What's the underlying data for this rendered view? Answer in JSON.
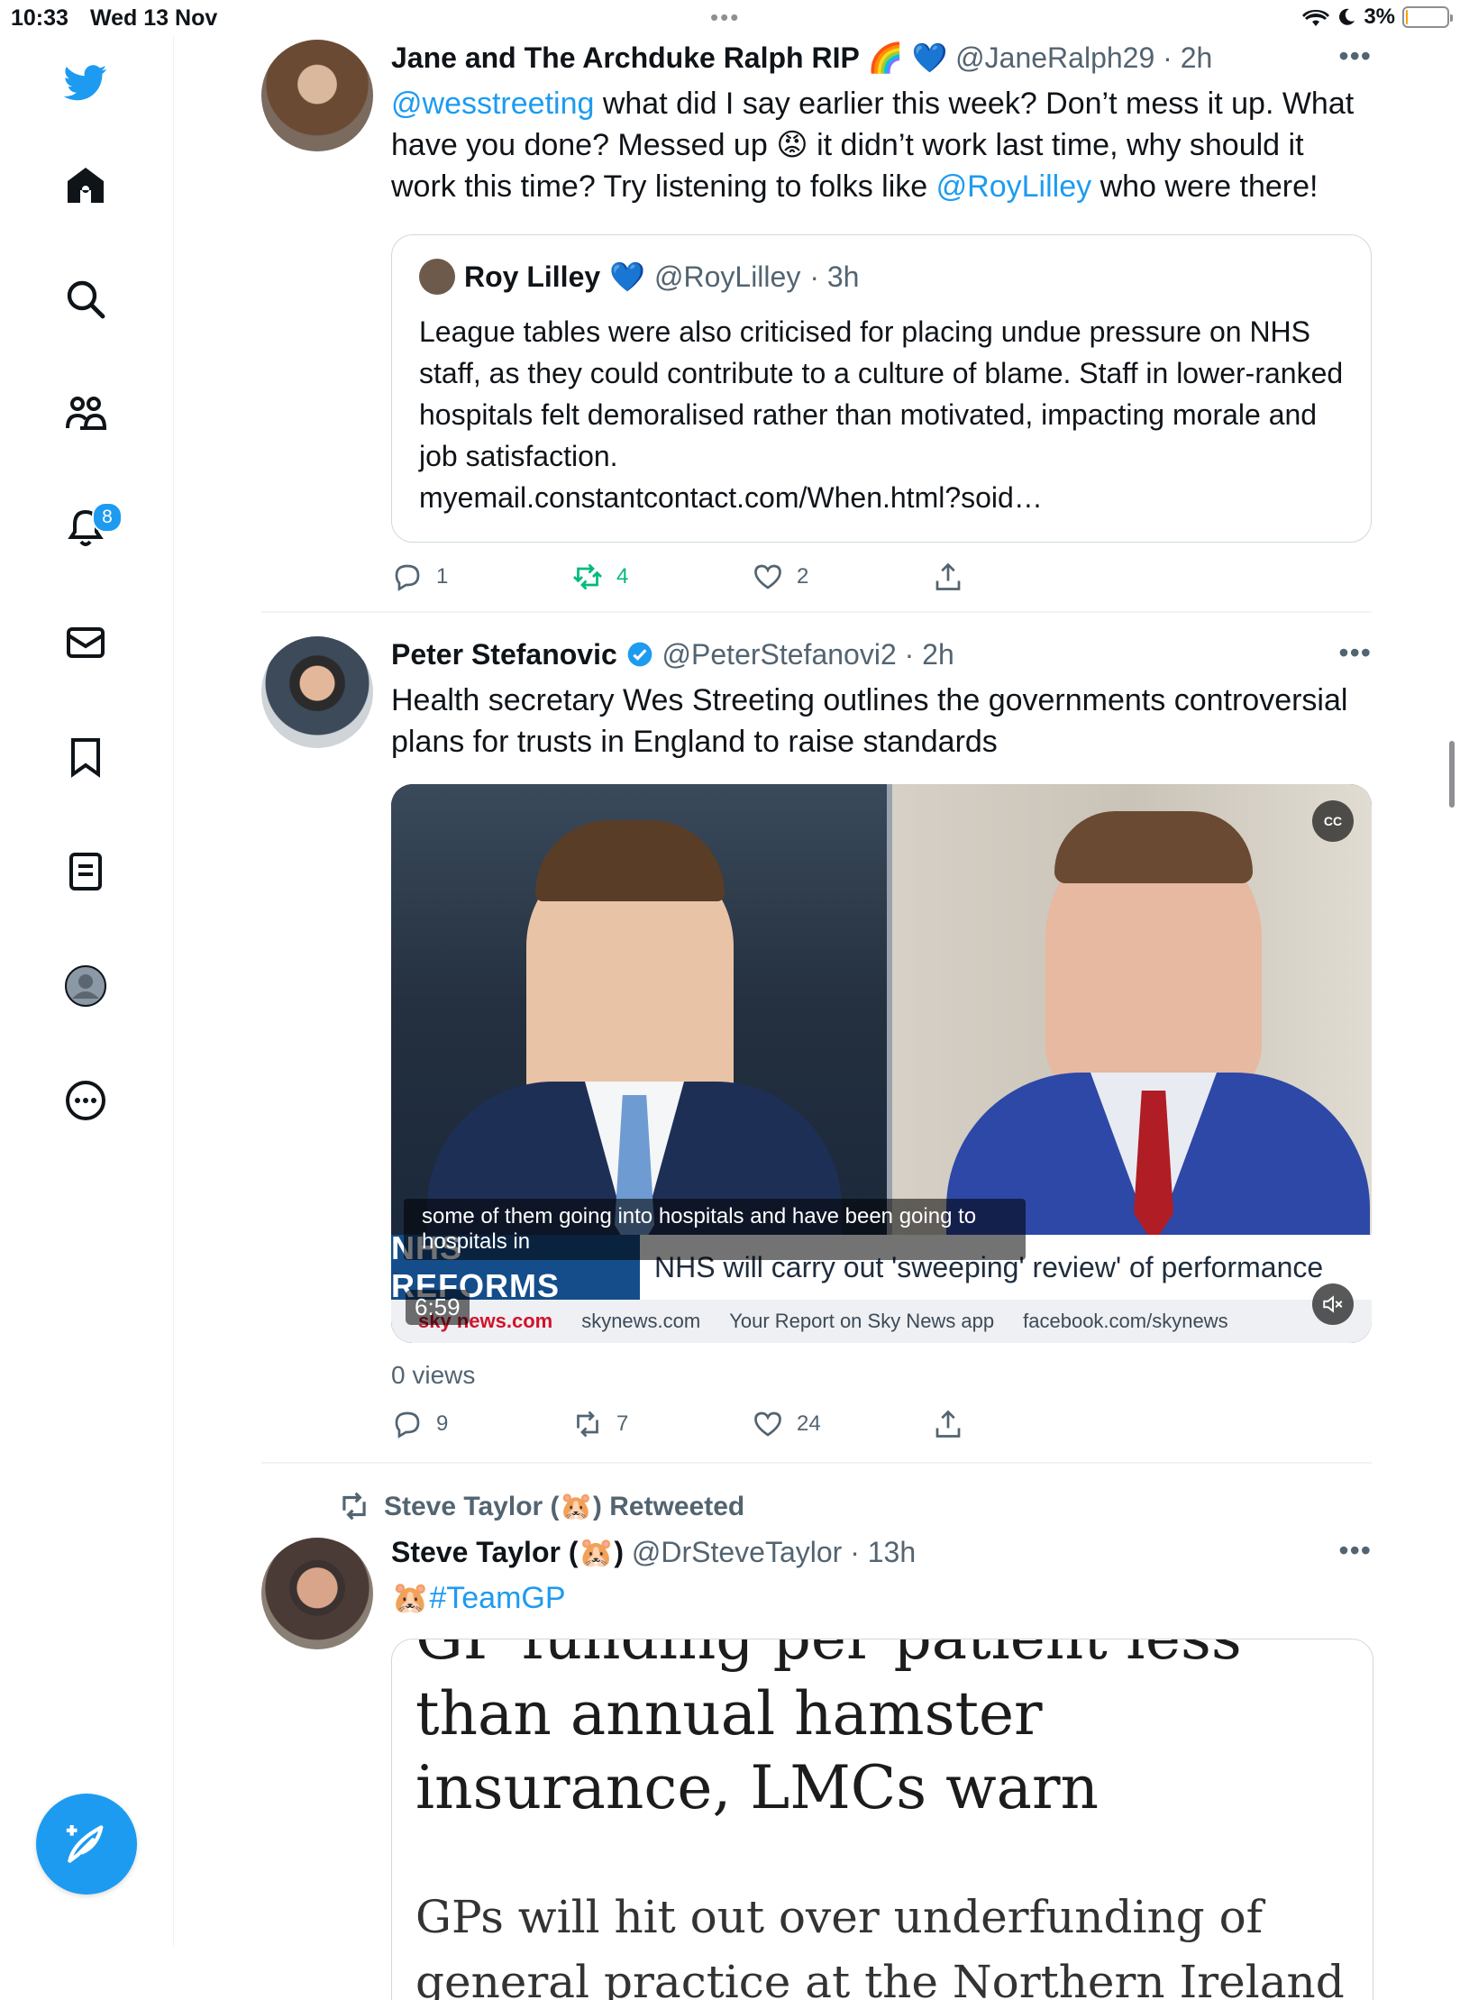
{
  "status_bar": {
    "time": "10:33",
    "date": "Wed 13 Nov",
    "battery": "3%",
    "battery_level": 0.03,
    "battery_color": "#ff9f0a"
  },
  "sidebar": {
    "items": [
      {
        "name": "home",
        "icon": "home-icon"
      },
      {
        "name": "explore",
        "icon": "search-icon"
      },
      {
        "name": "communities",
        "icon": "communities-icon"
      },
      {
        "name": "notifications",
        "icon": "bell-icon",
        "badge": "8"
      },
      {
        "name": "messages",
        "icon": "envelope-icon"
      },
      {
        "name": "bookmarks",
        "icon": "bookmark-icon"
      },
      {
        "name": "lists",
        "icon": "list-icon"
      },
      {
        "name": "profile",
        "icon": "profile-icon"
      },
      {
        "name": "more",
        "icon": "more-circle-icon"
      }
    ],
    "brand_color": "#1d9bf0"
  },
  "tweets": [
    {
      "name": "Jane and The Archduke Ralph RIP",
      "name_emoji": "🌈 💙",
      "handle": "@JaneRalph29",
      "time": "· 2h",
      "more": "•••",
      "text_parts": {
        "mention1": "@wesstreeting",
        "t1": " what did I say earlier this week? Don’t mess it up. What have you done? Messed up ",
        "emoji": "😡",
        "t2": " it didn’t work last time, why should it work this time? Try listening to folks like ",
        "mention2": "@RoyLilley",
        "t3": " who were there!"
      },
      "quote": {
        "name": "Roy Lilley",
        "emoji": "💙",
        "handle": "@RoyLilley",
        "time": "· 3h",
        "text": "League tables were also criticised for placing undue pressure on NHS staff, as they could contribute to a culture of blame. Staff in lower-ranked hospitals felt demoralised rather than motivated, impacting morale and job satisfaction.",
        "link": "myemail.constantcontact.com/When.html?soid…"
      },
      "actions": {
        "replies": "1",
        "retweets": "4",
        "likes": "2"
      }
    },
    {
      "name": "Peter Stefanovic",
      "handle": "@PeterStefanovi2",
      "time": "· 2h",
      "more": "•••",
      "text": "Health secretary Wes Streeting outlines the governments controversial plans for trusts in England to raise standards",
      "video": {
        "caption": "some of them going into hospitals and have been going to hospitals in",
        "ticker_tag": "NHS REFORMS",
        "ticker_text": "NHS will carry out 'sweeping' review' of performance",
        "strip_brand": "sky news.com",
        "strip_items": [
          "skynews.com",
          "Your Report on Sky News app",
          "facebook.com/skynews"
        ],
        "duration": "6:59",
        "cc": "CC"
      },
      "views": "0 views",
      "actions": {
        "replies": "9",
        "retweets": "7",
        "likes": "24"
      }
    },
    {
      "retweeted_by": "Steve Taylor (🐹) Retweeted",
      "name": "Steve Taylor (🐹)",
      "handle": "@DrSteveTaylor",
      "time": "· 13h",
      "more": "•••",
      "text_emoji": "🐹",
      "hashtag": "#TeamGP",
      "article": {
        "cut_line": "GP funding per patient less",
        "headline": "than annual hamster insurance, LMCs warn",
        "subline": "GPs will hit out over underfunding of general practice at the Northern Ireland"
      }
    }
  ]
}
